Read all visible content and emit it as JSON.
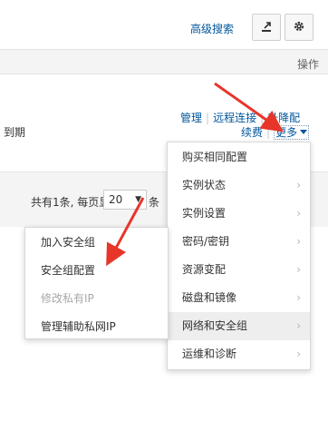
{
  "toolbar": {
    "advanced_search": "高级搜索",
    "export_icon": "export-icon",
    "settings_icon": "gear-icon"
  },
  "table": {
    "header_action": "操作",
    "row": {
      "expire_text": "到期",
      "actions": {
        "manage": "管理",
        "remote_connect": "远程连接",
        "upgrade": "升降配",
        "renew": "续费",
        "more": "更多"
      }
    }
  },
  "pagination": {
    "summary": "共有1条, 每页显示:",
    "page_size": "20",
    "suffix": "条"
  },
  "more_menu": {
    "items": [
      {
        "label": "购买相同配置",
        "has_submenu": false
      },
      {
        "label": "实例状态",
        "has_submenu": true
      },
      {
        "label": "实例设置",
        "has_submenu": true
      },
      {
        "label": "密码/密钥",
        "has_submenu": true
      },
      {
        "label": "资源变配",
        "has_submenu": true
      },
      {
        "label": "磁盘和镜像",
        "has_submenu": true
      },
      {
        "label": "网络和安全组",
        "has_submenu": true,
        "active": true
      },
      {
        "label": "运维和诊断",
        "has_submenu": true
      }
    ]
  },
  "network_submenu": {
    "items": [
      {
        "label": "加入安全组",
        "disabled": false
      },
      {
        "label": "安全组配置",
        "disabled": false
      },
      {
        "label": "修改私有IP",
        "disabled": true
      },
      {
        "label": "管理辅助私网IP",
        "disabled": false
      }
    ]
  },
  "colors": {
    "link": "#00569b",
    "annotation_arrow": "#e8352a",
    "menu_active_bg": "#eeeeee",
    "disabled_text": "#a8a8a8"
  }
}
